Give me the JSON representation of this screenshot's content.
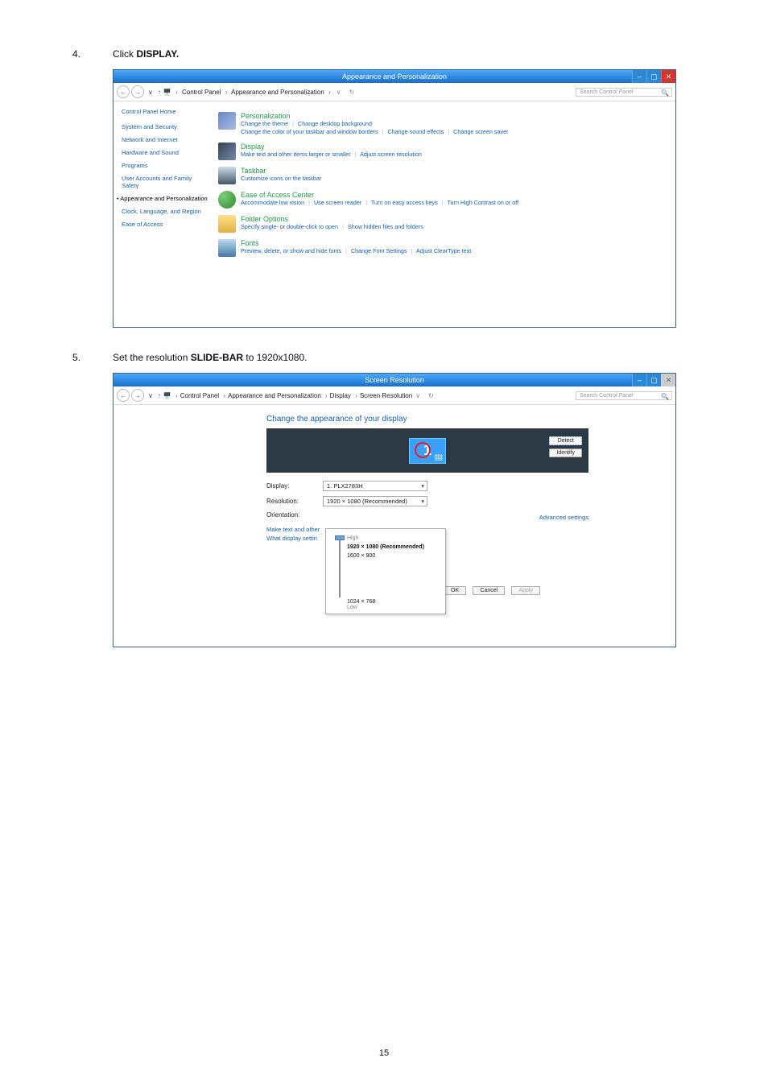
{
  "page_number": "15",
  "steps": [
    {
      "num": "4.",
      "pre": "Click ",
      "bold": "DISPLAY.",
      "post": ""
    },
    {
      "num": "5.",
      "pre": "Set the resolution ",
      "bold": "SLIDE-BAR",
      "post": " to 1920x1080."
    }
  ],
  "common": {
    "search_placeholder": "Search Control Panel",
    "refresh_hint": "↻",
    "mag": "🔍",
    "navback": "←",
    "navfwd": "→",
    "navup": "↑",
    "winmin": "–",
    "winmax": "▢",
    "winclose": "✕",
    "vbar": "∨"
  },
  "win1": {
    "title": "Appearance and Personalization",
    "crumbs": [
      "Control Panel",
      "Appearance and Personalization"
    ],
    "left": {
      "home": "Control Panel Home",
      "items": [
        "System and Security",
        "Network and Internet",
        "Hardware and Sound",
        "Programs",
        "User Accounts and Family Safety",
        "Appearance and Personalization",
        "Clock, Language, and Region",
        "Ease of Access"
      ],
      "current_index": 5
    },
    "cats": [
      {
        "title": "Personalization",
        "links": [
          "Change the theme",
          "Change desktop background",
          "Change the color of your taskbar and window borders",
          "Change sound effects",
          "Change screen saver"
        ]
      },
      {
        "title": "Display",
        "links": [
          "Make text and other items larger or smaller",
          "Adjust screen resolution"
        ]
      },
      {
        "title": "Taskbar",
        "links": [
          "Customize icons on the taskbar"
        ]
      },
      {
        "title": "Ease of Access Center",
        "links": [
          "Accommodate low vision",
          "Use screen reader",
          "Turn on easy access keys",
          "Turn High Contrast on or off"
        ]
      },
      {
        "title": "Folder Options",
        "links": [
          "Specify single- or double-click to open",
          "Show hidden files and folders"
        ]
      },
      {
        "title": "Fonts",
        "links": [
          "Preview, delete, or show and hide fonts",
          "Change Font Settings",
          "Adjust ClearType text"
        ]
      }
    ]
  },
  "win2": {
    "title": "Screen Resolution",
    "crumbs": [
      "Control Panel",
      "Appearance and Personalization",
      "Display",
      "Screen Resolution"
    ],
    "heading": "Change the appearance of your display",
    "detect": "Detect",
    "identify": "Identify",
    "monitor_num": "1",
    "labels": {
      "display": "Display:",
      "resolution": "Resolution:",
      "orientation": "Orientation:"
    },
    "display_value": "1. PLX2783H",
    "resolution_value": "1920 × 1080 (Recommended)",
    "slider": {
      "high": "High",
      "rec": "1920 × 1080 (Recommended)",
      "mid": "1600 × 900",
      "low_value": "1024 × 768",
      "low_label": "Low"
    },
    "links": {
      "make": "Make text and other",
      "what": "What display settin",
      "adv": "Advanced settings"
    },
    "buttons": {
      "ok": "OK",
      "cancel": "Cancel",
      "apply": "Apply"
    }
  }
}
